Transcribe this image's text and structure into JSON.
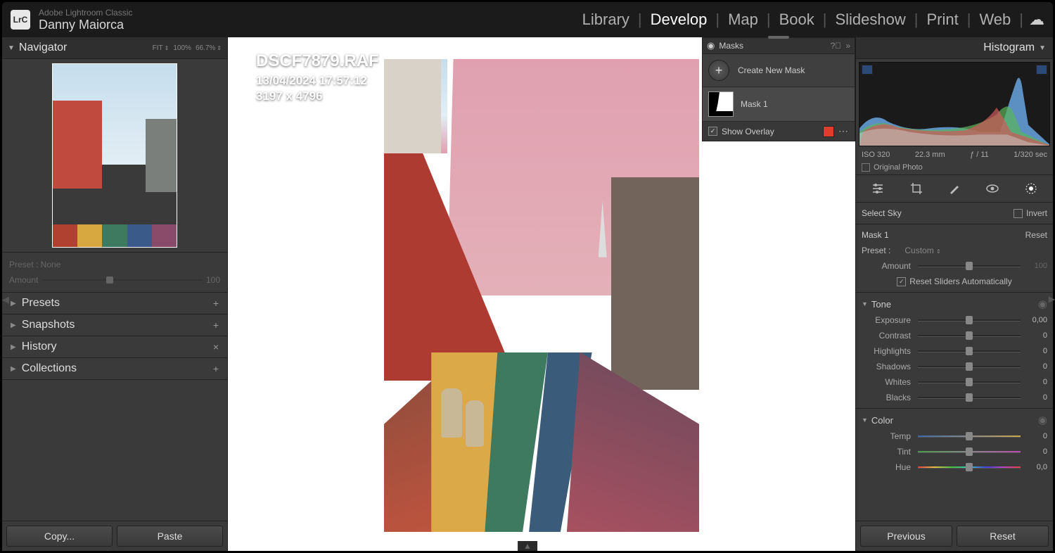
{
  "app": {
    "logo": "LrC",
    "name": "Adobe Lightroom Classic",
    "user": "Danny Maiorca"
  },
  "modules": {
    "library": "Library",
    "develop": "Develop",
    "map": "Map",
    "book": "Book",
    "slideshow": "Slideshow",
    "print": "Print",
    "web": "Web"
  },
  "left": {
    "navigator": "Navigator",
    "zoom": {
      "fit": "FIT",
      "z100": "100%",
      "z667": "66.7%"
    },
    "preset_label": "Preset : None",
    "amount_label": "Amount",
    "amount_value": "100",
    "presets": "Presets",
    "snapshots": "Snapshots",
    "history": "History",
    "collections": "Collections",
    "copy": "Copy...",
    "paste": "Paste"
  },
  "overlay": {
    "filename": "DSCF7879.RAF",
    "datetime": "13/04/2024 17:57:12",
    "dimensions": "3197 x 4796"
  },
  "masks": {
    "title": "Masks",
    "create": "Create New Mask",
    "mask1": "Mask 1",
    "show_overlay": "Show Overlay"
  },
  "right": {
    "histogram": "Histogram",
    "meta": {
      "iso": "ISO 320",
      "focal": "22.3 mm",
      "aperture": "ƒ / 11",
      "shutter": "1/320 sec"
    },
    "original": "Original Photo",
    "select_sky": "Select Sky",
    "invert": "Invert",
    "mask_name": "Mask 1",
    "reset": "Reset",
    "preset_label": "Preset :",
    "preset_value": "Custom",
    "amount_label": "Amount",
    "amount_value": "100",
    "reset_sliders": "Reset Sliders Automatically",
    "tone": {
      "title": "Tone",
      "exposure": {
        "label": "Exposure",
        "value": "0,00"
      },
      "contrast": {
        "label": "Contrast",
        "value": "0"
      },
      "highlights": {
        "label": "Highlights",
        "value": "0"
      },
      "shadows": {
        "label": "Shadows",
        "value": "0"
      },
      "whites": {
        "label": "Whites",
        "value": "0"
      },
      "blacks": {
        "label": "Blacks",
        "value": "0"
      }
    },
    "color": {
      "title": "Color",
      "temp": {
        "label": "Temp",
        "value": "0"
      },
      "tint": {
        "label": "Tint",
        "value": "0"
      },
      "hue": {
        "label": "Hue",
        "value": "0,0"
      }
    },
    "previous": "Previous",
    "reset_btn": "Reset"
  }
}
